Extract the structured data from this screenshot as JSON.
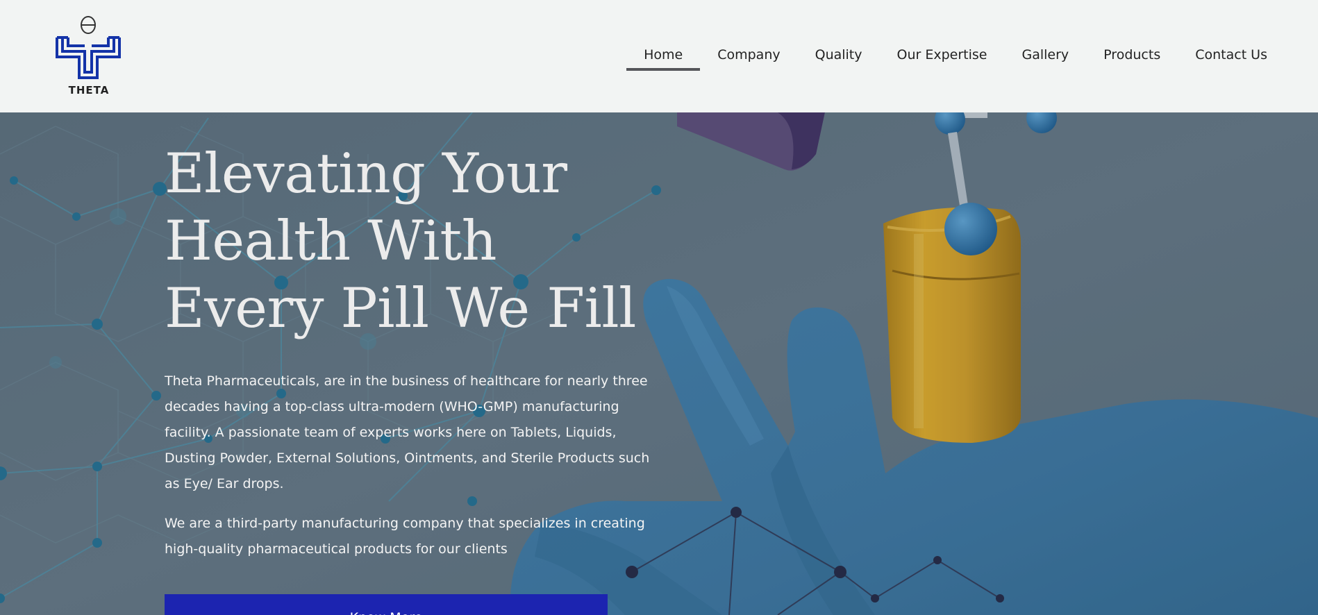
{
  "brand": {
    "logo_text": "THETA",
    "logo_icon": "theta-logo-icon",
    "logo_color": "#1433a8"
  },
  "nav": {
    "items": [
      {
        "label": "Home",
        "active": true
      },
      {
        "label": "Company"
      },
      {
        "label": "Quality"
      },
      {
        "label": "Our Expertise"
      },
      {
        "label": "Gallery"
      },
      {
        "label": "Products"
      },
      {
        "label": "Contact Us"
      }
    ]
  },
  "hero": {
    "title_lines": [
      "Elevating Your",
      "Health With",
      "Every Pill We Fill"
    ],
    "paragraph1": "Theta Pharmaceuticals, are in the business of healthcare for nearly three decades having a top-class ultra-modern (WHO-GMP) manufacturing facility. A passionate team of experts works here on Tablets, Liquids, Dusting Powder, External Solutions, Ointments, and Sterile Products such as Eye/ Ear drops.",
    "paragraph2": "We are a third-party manufacturing company that specializes in creating high-quality pharmaceutical products for our clients",
    "cta_label": "Know More",
    "background_image": "gloved-hand-holding-capsule-with-molecule-network",
    "overlay_color": "#5f7280",
    "cta_color": "#1c24b0"
  }
}
